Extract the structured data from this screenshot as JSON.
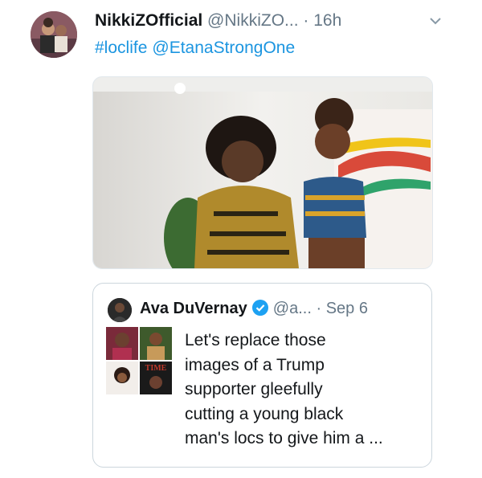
{
  "tweet": {
    "display_name": "NikkiZOfficial",
    "handle": "@NikkiZO...",
    "separator": "·",
    "time": "16h",
    "hashtag": "#loclife",
    "mention": "@EtanaStrongOne",
    "menu_icon": "chevron-down-icon"
  },
  "quoted_tweet": {
    "display_name": "Ava DuVernay",
    "handle": "@a...",
    "separator": "·",
    "date": "Sep 6",
    "verified_icon": "verified-badge-icon",
    "thumbnail_text": "TIME",
    "text_lines": [
      "Let's replace those",
      "images of a Trump",
      "supporter gleefully",
      "cutting a young black",
      "man's locs to give him a ..."
    ]
  },
  "colors": {
    "link": "#1b95e0",
    "secondary_text": "#657786",
    "verified": "#1da1f2",
    "border": "#ccd6dd"
  }
}
